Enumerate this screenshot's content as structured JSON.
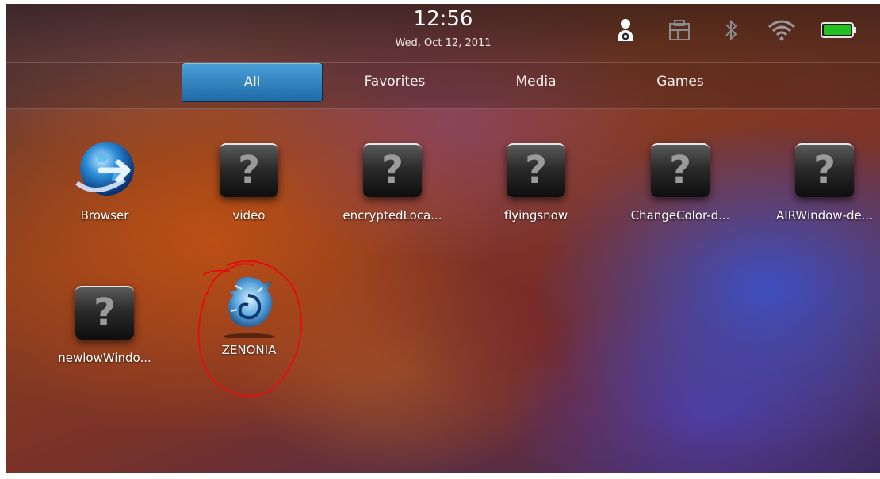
{
  "status": {
    "time": "12:56",
    "date": "Wed, Oct 12, 2011",
    "icons": [
      "account-settings-icon",
      "device-icon",
      "bluetooth-icon",
      "wifi-icon",
      "battery-icon"
    ],
    "battery_color": "#22c022"
  },
  "tabs": [
    {
      "label": "All",
      "active": true
    },
    {
      "label": "Favorites",
      "active": false
    },
    {
      "label": "Media",
      "active": false
    },
    {
      "label": "Games",
      "active": false
    }
  ],
  "apps": [
    {
      "label": "Browser",
      "icon": "globe-icon"
    },
    {
      "label": "video",
      "icon": "question-mark-icon"
    },
    {
      "label": "encryptedLoca...",
      "icon": "question-mark-icon"
    },
    {
      "label": "flyingsnow",
      "icon": "question-mark-icon"
    },
    {
      "label": "ChangeColor-d...",
      "icon": "question-mark-icon"
    },
    {
      "label": "AIRWindow-de...",
      "icon": "question-mark-icon"
    },
    {
      "label": "newlowWindo...",
      "icon": "question-mark-icon"
    },
    {
      "label": "ZENONIA",
      "icon": "dragon-icon"
    }
  ],
  "colors": {
    "tab_active": "#2a7fc0",
    "annotation": "#e01010"
  }
}
